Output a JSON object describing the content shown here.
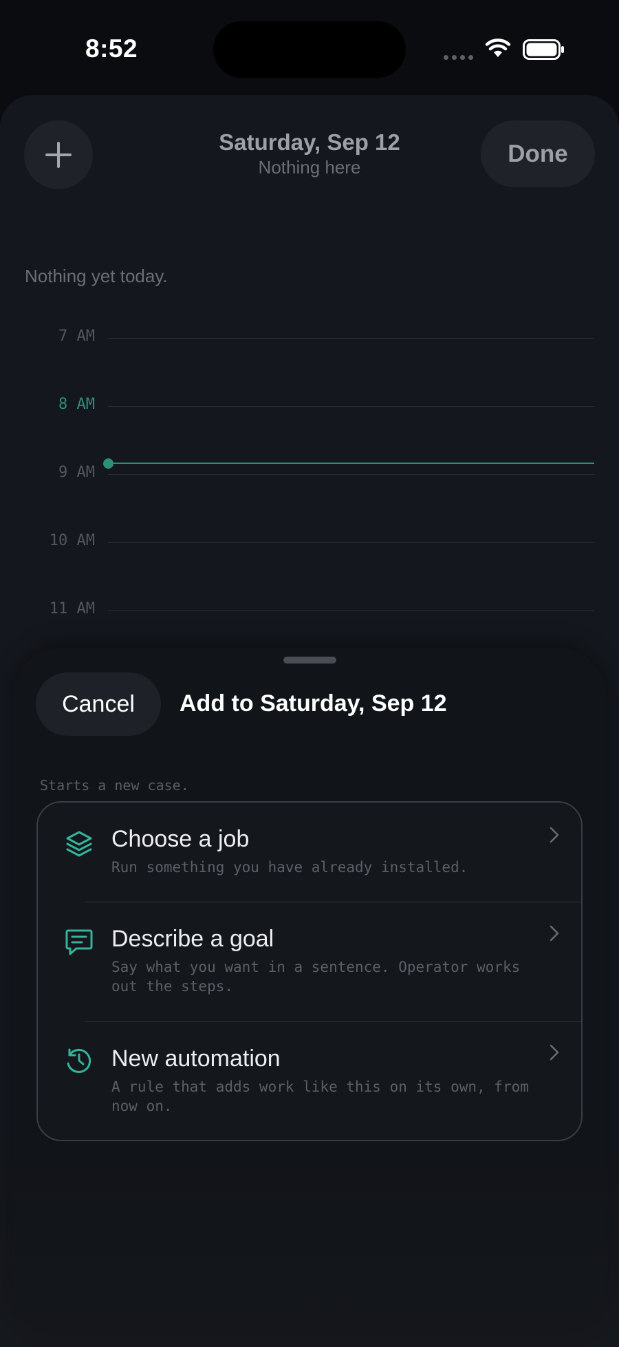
{
  "status_bar": {
    "time": "8:52"
  },
  "header": {
    "title": "Saturday, Sep 12",
    "subtitle": "Nothing here",
    "done_label": "Done"
  },
  "timeline": {
    "empty_note": "Nothing yet today.",
    "hours": [
      "7 AM",
      "8 AM",
      "9 AM",
      "10 AM",
      "11 AM"
    ],
    "current_hour": "8 AM",
    "accent_color": "#2c8f7a"
  },
  "add_sheet": {
    "cancel_label": "Cancel",
    "title": "Add to Saturday, Sep 12",
    "caption": "Starts a new case.",
    "options": [
      {
        "icon": "layers-icon",
        "title": "Choose a job",
        "description": "Run something you have already installed."
      },
      {
        "icon": "message-icon",
        "title": "Describe a goal",
        "description": "Say what you want in a sentence. Operator works out the steps."
      },
      {
        "icon": "history-clock-icon",
        "title": "New automation",
        "description": "A rule that adds work like this on its own, from now on."
      }
    ]
  }
}
